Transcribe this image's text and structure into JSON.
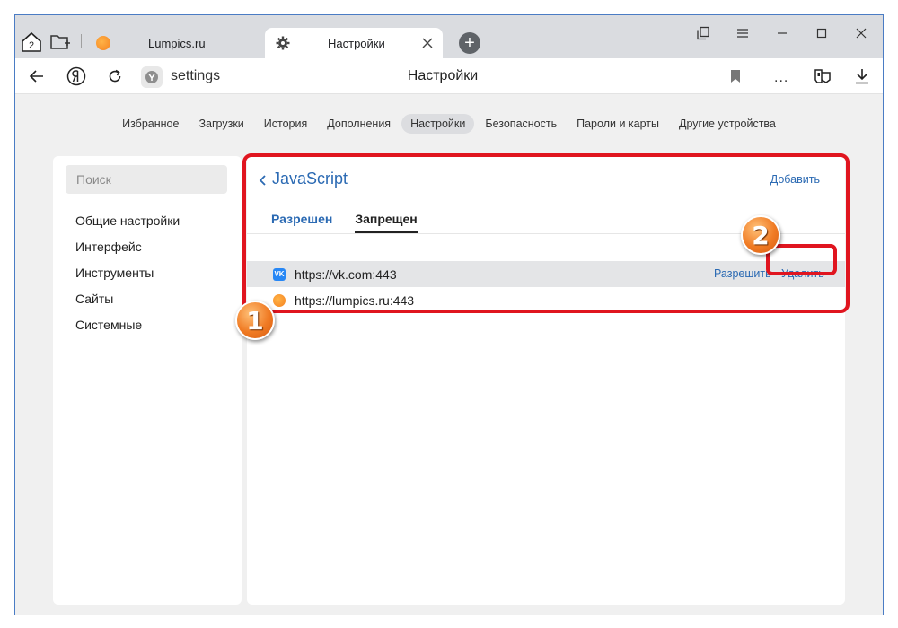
{
  "tabs": {
    "home_badge": "2",
    "inactive_title": "Lumpics.ru",
    "active_title": "Настройки",
    "new_tab_label": "+"
  },
  "address_bar": {
    "url": "settings",
    "page_title": "Настройки",
    "more_label": "..."
  },
  "nav": {
    "items": [
      {
        "label": "Избранное"
      },
      {
        "label": "Загрузки"
      },
      {
        "label": "История"
      },
      {
        "label": "Дополнения"
      },
      {
        "label": "Настройки"
      },
      {
        "label": "Безопасность"
      },
      {
        "label": "Пароли и карты"
      },
      {
        "label": "Другие устройства"
      }
    ],
    "active_index": 4
  },
  "sidebar": {
    "search_placeholder": "Поиск",
    "items": [
      {
        "label": "Общие настройки"
      },
      {
        "label": "Интерфейс"
      },
      {
        "label": "Инструменты"
      },
      {
        "label": "Сайты"
      },
      {
        "label": "Системные"
      }
    ]
  },
  "main": {
    "title": "JavaScript",
    "add_label": "Добавить",
    "tab_allowed": "Разрешен",
    "tab_blocked": "Запрещен",
    "sites": [
      {
        "favicon": "vk-icon",
        "host": "https://vk.com:443",
        "allow_label": "Разрешить",
        "delete_label": "Удалить"
      },
      {
        "favicon": "lumpics-icon",
        "host": "https://lumpics.ru:443"
      }
    ]
  },
  "callouts": {
    "one": "1",
    "two": "2"
  },
  "colors": {
    "accent": "#2b6ab3",
    "callout_red": "#e0151f",
    "badge_orange": "#f07b24"
  }
}
